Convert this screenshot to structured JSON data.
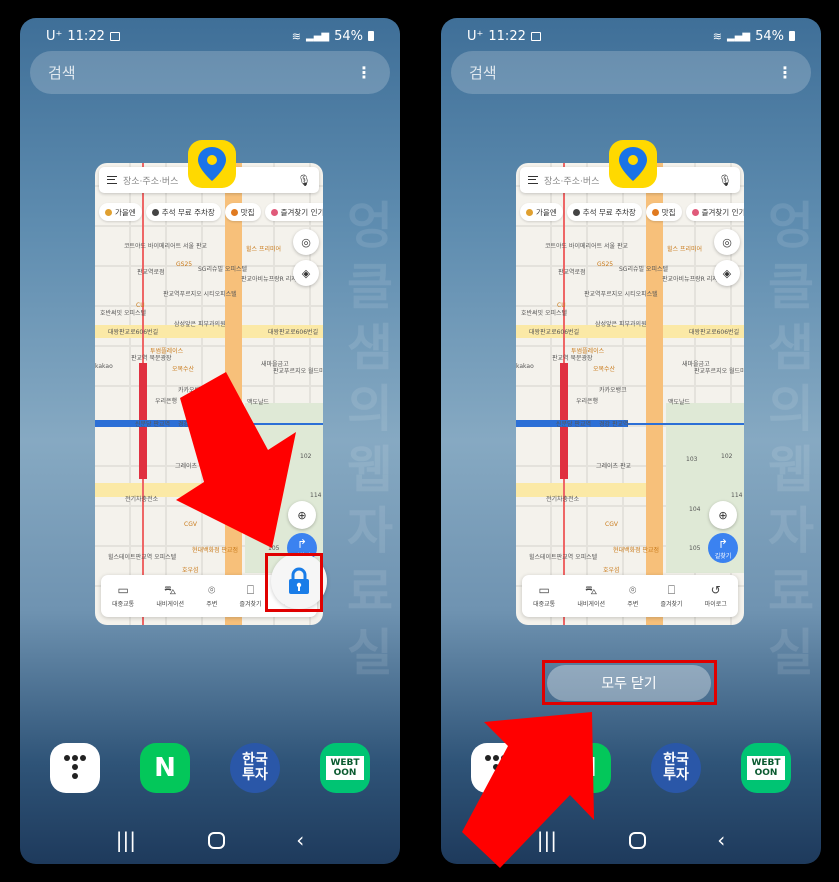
{
  "status": {
    "carrier": "U⁺",
    "time": "11:22",
    "battery": "54%"
  },
  "search_placeholder": "검색",
  "watermark": "엉클샘의웹자료실",
  "map_app": {
    "search_placeholder": "장소·주소·버스",
    "chips": [
      {
        "label": "가을엔",
        "color": "#e0a030"
      },
      {
        "label": "추석 무료 주차장",
        "color": "#444"
      },
      {
        "label": "맛집",
        "color": "#e07a20"
      },
      {
        "label": "즐겨찾기 인기스",
        "color": "#e05a7a"
      }
    ],
    "map_labels": [
      "코트야드 바이메리어트 서울 판교",
      "판교역로점",
      "GS25",
      "SG리슈빌 오피스텔",
      "판교역푸르지오 시티오피스텔",
      "CU",
      "호반써밋 오피스텔",
      "삼성앞은 피부과의원",
      "힐스 프리미어",
      "판교아비뉴프랑R 리저브",
      "대왕판교로606번길",
      "대왕판교로606번길",
      "판교역 북문광장",
      "투썸플레이스",
      "오복수산",
      "새마을금고",
      "판교푸르지오 월드마크아파트",
      "카카오뱅크",
      "kakao",
      "신분당 판교역",
      "경강 판교역",
      "그레이츠 판교",
      "전기차충전소",
      "CGV",
      "현대백화점 판교점",
      "힐스테이트판교역 오피스텔",
      "호우섬",
      "103",
      "102",
      "104",
      "114",
      "105",
      "맥도날드",
      "우리은행"
    ],
    "route_button": "길찾기",
    "bottom_nav": [
      {
        "label": "대중교통",
        "icon": "bus-icon"
      },
      {
        "label": "내비게이션",
        "icon": "car-icon"
      },
      {
        "label": "주변",
        "icon": "location-pin-icon"
      },
      {
        "label": "즐겨찾기",
        "icon": "bookmark-icon"
      },
      {
        "label": "마이로그",
        "icon": "history-icon"
      }
    ]
  },
  "close_all_label": "모두 닫기",
  "dock": [
    {
      "name": "t-app",
      "label": ""
    },
    {
      "name": "naver",
      "label": "N"
    },
    {
      "name": "korea-investment",
      "label": "한국투자"
    },
    {
      "name": "webtoon",
      "label": "WEBTOON"
    }
  ],
  "colors": {
    "highlight": "#e00000",
    "accent": "#3b82f0",
    "app_icon": "#ffd900"
  }
}
